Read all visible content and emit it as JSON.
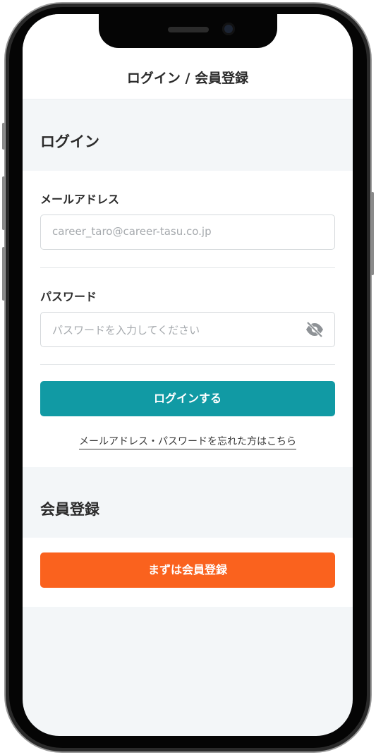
{
  "header": {
    "title": "ログイン / 会員登録"
  },
  "login": {
    "section_title": "ログイン",
    "email_label": "メールアドレス",
    "email_placeholder": "career_taro@career-tasu.co.jp",
    "password_label": "パスワード",
    "password_placeholder": "パスワードを入力してください",
    "password_toggle_icon": "eye-slash-icon",
    "submit_label": "ログインする",
    "forgot_link": "メールアドレス・パスワードを忘れた方はこちら"
  },
  "register": {
    "section_title": "会員登録",
    "submit_label": "まずは会員登録"
  },
  "colors": {
    "primary_teal": "#119aa4",
    "accent_orange": "#fa621e",
    "section_bg": "#f3f6f8"
  }
}
